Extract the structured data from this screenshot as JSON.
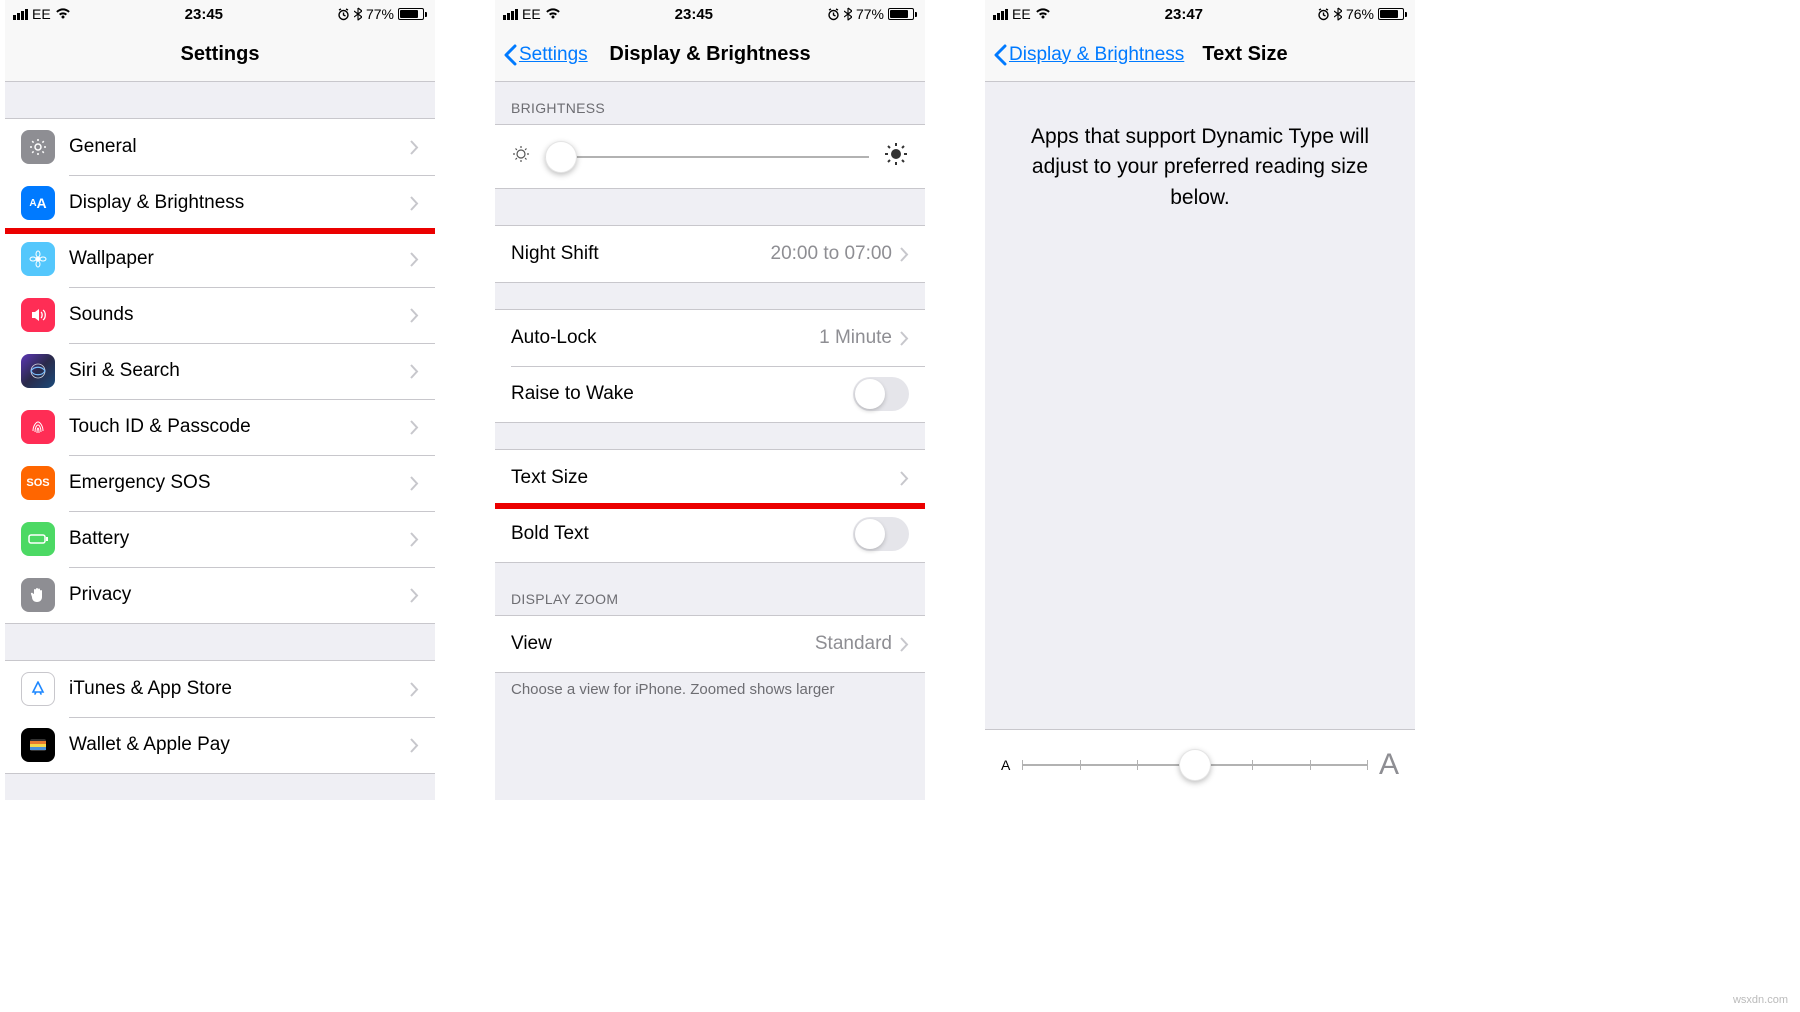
{
  "statusBar": {
    "carrier": "EE",
    "time1": "23:45",
    "time2": "23:45",
    "time3": "23:47",
    "battery1": "77%",
    "battery2": "77%",
    "battery3": "76%"
  },
  "screen1": {
    "title": "Settings",
    "items": [
      {
        "label": "General"
      },
      {
        "label": "Display & Brightness"
      },
      {
        "label": "Wallpaper"
      },
      {
        "label": "Sounds"
      },
      {
        "label": "Siri & Search"
      },
      {
        "label": "Touch ID & Passcode"
      },
      {
        "label": "Emergency SOS"
      },
      {
        "label": "Battery"
      },
      {
        "label": "Privacy"
      }
    ],
    "items2": [
      {
        "label": "iTunes & App Store"
      },
      {
        "label": "Wallet & Apple Pay"
      }
    ],
    "sosLabel": "SOS"
  },
  "screen2": {
    "back": "Settings",
    "title": "Display & Brightness",
    "brightnessHeader": "BRIGHTNESS",
    "nightShift": {
      "label": "Night Shift",
      "value": "20:00 to 07:00"
    },
    "autoLock": {
      "label": "Auto-Lock",
      "value": "1 Minute"
    },
    "raiseToWake": "Raise to Wake",
    "textSize": "Text Size",
    "boldText": "Bold Text",
    "displayZoomHeader": "DISPLAY ZOOM",
    "view": {
      "label": "View",
      "value": "Standard"
    },
    "footer": "Choose a view for iPhone. Zoomed shows larger"
  },
  "screen3": {
    "back": "Display & Brightness",
    "title": "Text Size",
    "description": "Apps that support Dynamic Type will adjust to your preferred reading size below.",
    "letterA": "A"
  },
  "watermark": "wsxdn.com"
}
